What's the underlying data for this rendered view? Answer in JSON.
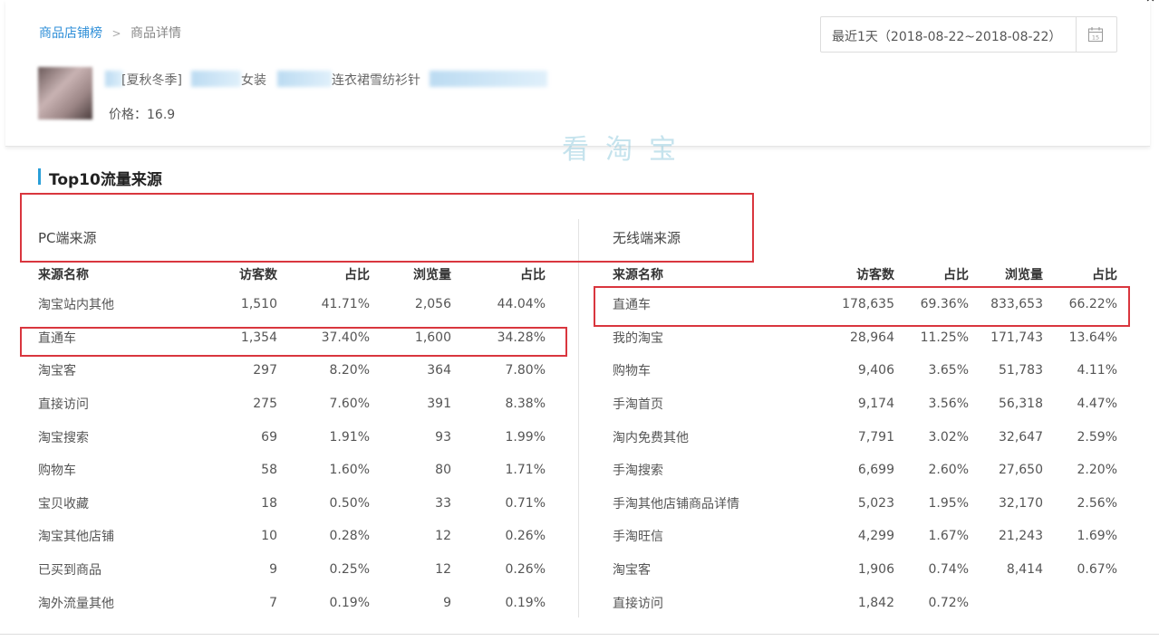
{
  "breadcrumb": {
    "link": "商品店铺榜",
    "separator": ">",
    "current": "商品详情"
  },
  "product": {
    "title_fragments": [
      "[夏秋冬季]",
      "女装",
      "连衣裙雪纺衫针"
    ],
    "price": "价格：16.9"
  },
  "date_range": {
    "label": "最近1天（2018-08-22~2018-08-22）",
    "calendar_icon": "calendar-icon",
    "calendar_day": "15"
  },
  "watermark": "看淘宝",
  "section": {
    "title": "Top10流量来源"
  },
  "pc": {
    "title": "PC端来源",
    "headers": [
      "来源名称",
      "访客数",
      "占比",
      "浏览量",
      "占比"
    ],
    "rows": [
      [
        "淘宝站内其他",
        "1,510",
        "41.71%",
        "2,056",
        "44.04%"
      ],
      [
        "直通车",
        "1,354",
        "37.40%",
        "1,600",
        "34.28%"
      ],
      [
        "淘宝客",
        "297",
        "8.20%",
        "364",
        "7.80%"
      ],
      [
        "直接访问",
        "275",
        "7.60%",
        "391",
        "8.38%"
      ],
      [
        "淘宝搜索",
        "69",
        "1.91%",
        "93",
        "1.99%"
      ],
      [
        "购物车",
        "58",
        "1.60%",
        "80",
        "1.71%"
      ],
      [
        "宝贝收藏",
        "18",
        "0.50%",
        "33",
        "0.71%"
      ],
      [
        "淘宝其他店铺",
        "10",
        "0.28%",
        "12",
        "0.26%"
      ],
      [
        "已买到商品",
        "9",
        "0.25%",
        "12",
        "0.26%"
      ],
      [
        "淘外流量其他",
        "7",
        "0.19%",
        "9",
        "0.19%"
      ]
    ]
  },
  "wireless": {
    "title": "无线端来源",
    "headers": [
      "来源名称",
      "访客数",
      "占比",
      "浏览量",
      "占比"
    ],
    "rows": [
      [
        "直通车",
        "178,635",
        "69.36%",
        "833,653",
        "66.22%"
      ],
      [
        "我的淘宝",
        "28,964",
        "11.25%",
        "171,743",
        "13.64%"
      ],
      [
        "购物车",
        "9,406",
        "3.65%",
        "51,783",
        "4.11%"
      ],
      [
        "手淘首页",
        "9,174",
        "3.56%",
        "56,318",
        "4.47%"
      ],
      [
        "淘内免费其他",
        "7,791",
        "3.02%",
        "32,647",
        "2.59%"
      ],
      [
        "手淘搜索",
        "6,699",
        "2.60%",
        "27,650",
        "2.20%"
      ],
      [
        "手淘其他店铺商品详情",
        "5,023",
        "1.95%",
        "32,170",
        "2.56%"
      ],
      [
        "手淘旺信",
        "4,299",
        "1.67%",
        "21,243",
        "1.69%"
      ],
      [
        "淘宝客",
        "1,906",
        "0.74%",
        "8,414",
        "0.67%"
      ],
      [
        "直接访问",
        "1,842",
        "0.72%",
        "",
        ""
      ]
    ]
  },
  "colors": {
    "accent": "#2a9fd8",
    "link": "#2f8fd8",
    "highlight_box": "#d9363e"
  }
}
